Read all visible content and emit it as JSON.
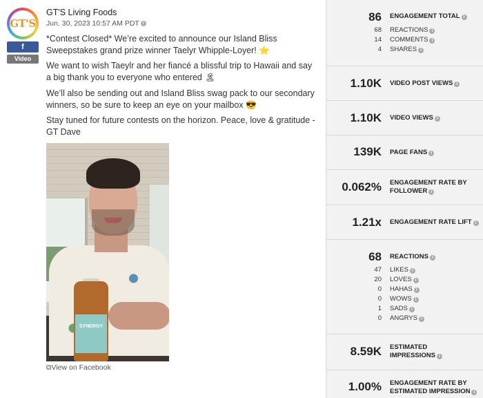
{
  "post": {
    "logo_text": "GT'S",
    "network_badge": "f",
    "type_badge": "Video",
    "author": "GT'S Living Foods",
    "date": "Jun. 30, 2023 10:57 AM PDT",
    "paragraphs": [
      "*Contest Closed* We’re excited to announce our Island Bliss Sweepstakes grand prize winner Taelyr Whipple-Loyer! ⭐",
      "We want to wish Taeylr and her fiancé a blissful trip to Hawaii and say a big thank you to everyone who entered 🏝",
      "We’ll also be sending out and Island Bliss swag pack to our secondary winners, so be sure to keep an eye on your mailbox 😎",
      "Stay tuned for future contests on the horizon. Peace, love & gratitude - GT Dave"
    ],
    "bottle_label": "SYNERGY",
    "view_link": "View on Facebook"
  },
  "metrics": {
    "engagement_total": {
      "value": "86",
      "label": "ENGAGEMENT TOTAL"
    },
    "engagement_breakdown": [
      {
        "value": "68",
        "label": "REACTIONS"
      },
      {
        "value": "14",
        "label": "COMMENTS"
      },
      {
        "value": "4",
        "label": "SHARES"
      }
    ],
    "video_post_views": {
      "value": "1.10K",
      "label": "VIDEO POST VIEWS"
    },
    "video_views": {
      "value": "1.10K",
      "label": "VIDEO VIEWS"
    },
    "page_fans": {
      "value": "139K",
      "label": "PAGE FANS"
    },
    "engagement_rate_follower": {
      "value": "0.062%",
      "label": "ENGAGEMENT RATE BY FOLLOWER"
    },
    "engagement_rate_lift": {
      "value": "1.21x",
      "label": "ENGAGEMENT RATE LIFT"
    },
    "reactions": {
      "value": "68",
      "label": "REACTIONS"
    },
    "reaction_breakdown": [
      {
        "value": "47",
        "label": "LIKES"
      },
      {
        "value": "20",
        "label": "LOVES"
      },
      {
        "value": "0",
        "label": "HAHAS"
      },
      {
        "value": "0",
        "label": "WOWS"
      },
      {
        "value": "1",
        "label": "SADS"
      },
      {
        "value": "0",
        "label": "ANGRYS"
      }
    ],
    "estimated_impressions": {
      "value": "8.59K",
      "label": "ESTIMATED IMPRESSIONS"
    },
    "engagement_rate_impression": {
      "value": "1.00%",
      "label": "ENGAGEMENT RATE BY ESTIMATED IMPRESSION"
    }
  },
  "info_icon_glyph": "i",
  "colors": {
    "facebook": "#3b5998",
    "panel": "#f2f2f2"
  }
}
